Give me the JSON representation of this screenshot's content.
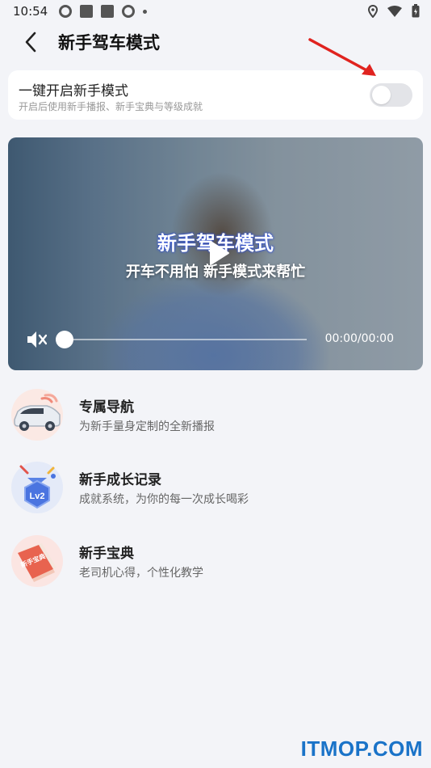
{
  "status_bar": {
    "time": "10:54"
  },
  "header": {
    "title": "新手驾车模式"
  },
  "toggle_card": {
    "title": "一键开启新手模式",
    "subtitle": "开启后使用新手播报、新手宝典与等级成就",
    "enabled": false
  },
  "video": {
    "title": "新手驾车模式",
    "subtitle": "开车不用怕 新手模式来帮忙",
    "time": "00:00/00:00",
    "progress": 0
  },
  "features": [
    {
      "name": "专属导航",
      "desc": "为新手量身定制的全新播报",
      "icon": "car-icon"
    },
    {
      "name": "新手成长记录",
      "desc": "成就系统，为你的每一次成长喝彩",
      "icon": "level-badge-icon"
    },
    {
      "name": "新手宝典",
      "desc": "老司机心得，个性化教学",
      "icon": "book-icon"
    }
  ],
  "badge_text": "Lv2",
  "book_text": "新手宝典",
  "watermark": "ITMOP.COM",
  "colors": {
    "accent": "#1a73c8",
    "arrow": "#e0231f",
    "page_bg": "#f3f4f8"
  }
}
